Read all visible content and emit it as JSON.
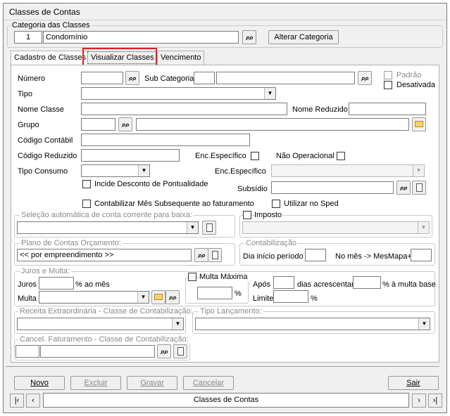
{
  "window": {
    "title": "Classes de Contas"
  },
  "categoria": {
    "legend": "Categoria das Classes",
    "code": "1",
    "name": "Condomínio",
    "alterar_label": "Alterar Categoria"
  },
  "tabs": [
    {
      "label": "Cadastro de Classes"
    },
    {
      "label": "Visualizar Classes"
    },
    {
      "label": "Vencimento"
    }
  ],
  "form": {
    "numero_label": "Número",
    "subcategoria_label": "Sub Categoria",
    "padrao_label": "Padrão",
    "desativada_label": "Desativada",
    "tipo_label": "Tipo",
    "nome_classe_label": "Nome Classe",
    "nome_reduzido_label": "Nome Reduzido",
    "grupo_label": "Grupo",
    "codigo_contabil_label": "Código Contábil",
    "codigo_reduzido_label": "Código Reduzido",
    "enc_especifico_label": "Enc.Específico",
    "nao_operacional_label": "Não Operacional",
    "tipo_consumo_label": "Tipo Consumo",
    "enc_especifico2_label": "Enc.Específico",
    "incide_desconto_label": "Incide Desconto de Pontualidade",
    "subsidio_label": "Subsídio",
    "contabilizar_label": "Contabilizar Mês Subsequente ao faturamento",
    "utilizar_sped_label": "Utilizar no Sped"
  },
  "selecao": {
    "legend": "Seleção automática de conta corrente para baixa:"
  },
  "imposto": {
    "label": "Imposto"
  },
  "plano": {
    "legend": "Plano de Contas Orçamento:",
    "value": "<< por empreendimento >>"
  },
  "contabilizacao": {
    "legend": "Contabilização",
    "dia_inicio_label": "Dia início período",
    "no_mes_label": "No mês -> MesMapa+"
  },
  "juros": {
    "legend": "Juros e Multa:",
    "juros_label": "Juros",
    "ao_mes_label": "% ao mês",
    "multa_label": "Multa",
    "multa_maxima_label": "Multa Máxima",
    "pct_label": "%",
    "apos_label": "Após",
    "dias_label": "dias acrescentar",
    "a_multa_base_label": "% à multa base",
    "limite_label": "Limite",
    "limite_pct_label": "%"
  },
  "receita": {
    "legend": "Receita Extraordinária - Classe de Contabilização:"
  },
  "tipo_lancamento": {
    "legend": "Tipo Lançamento:"
  },
  "cancel": {
    "legend": "Cancel. Faturamento - Classe de Contabilização:"
  },
  "buttons": {
    "novo": "Novo",
    "excluir": "Excluir",
    "gravar": "Gravar",
    "cancelar": "Cancelar",
    "sair": "Sair"
  },
  "navigator": {
    "label": "Classes de Contas"
  }
}
